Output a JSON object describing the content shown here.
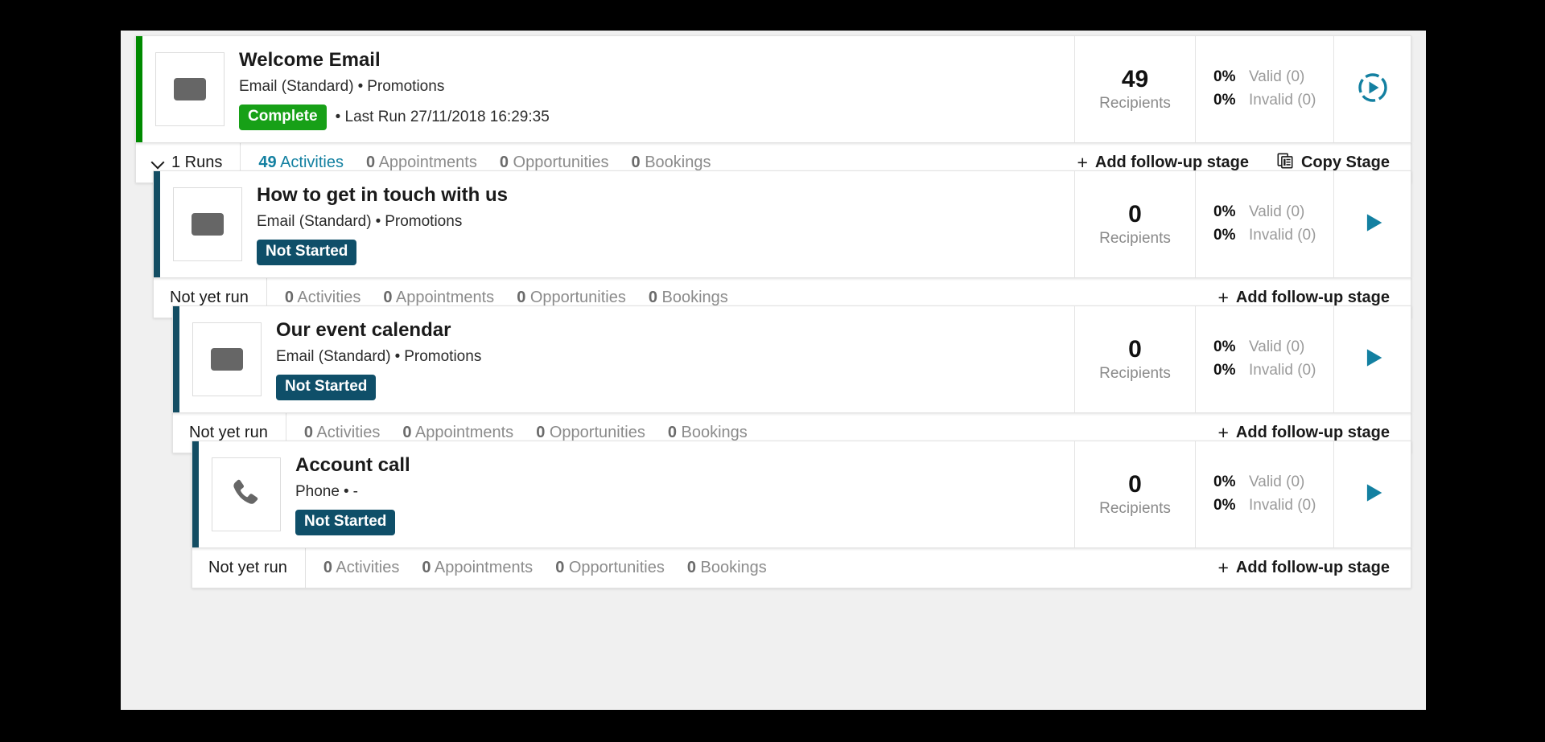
{
  "colors": {
    "accent_green": "#008a00",
    "accent_teal": "#134d63",
    "badge_complete": "#17a017",
    "badge_notstarted": "#0f4f69",
    "link_teal": "#1380a1",
    "play_teal": "#1380a1"
  },
  "stages": [
    {
      "id": "welcome-email",
      "title": "Welcome Email",
      "channel": "Email (Standard)",
      "separator": "•",
      "category": "Promotions",
      "status": "Complete",
      "status_kind": "complete",
      "last_run": "• Last Run 27/11/2018 16:29:35",
      "icon": "envelope-icon",
      "accent": "green",
      "metric_value": "49",
      "metric_label": "Recipients",
      "valid_pct": "0%",
      "valid_label": "Valid (0)",
      "invalid_pct": "0%",
      "invalid_label": "Invalid (0)",
      "action_icon": "play-progress-circle-icon",
      "runs_label": "1 Runs",
      "has_chevron": true,
      "tabs": [
        {
          "count": "49",
          "label": "Activities",
          "active": true
        },
        {
          "count": "0",
          "label": "Appointments",
          "active": false
        },
        {
          "count": "0",
          "label": "Opportunities",
          "active": false
        },
        {
          "count": "0",
          "label": "Bookings",
          "active": false
        }
      ],
      "add_stage_label": "Add follow-up stage",
      "add_stage_plus": "+",
      "copy_stage_label": "Copy Stage",
      "show_copy_stage": true
    },
    {
      "id": "how-to-get-in-touch-with-us",
      "title": "How to get in touch with us",
      "channel": "Email (Standard)",
      "separator": "•",
      "category": "Promotions",
      "status": "Not Started",
      "status_kind": "notstarted",
      "last_run": "",
      "icon": "envelope-icon",
      "accent": "teal",
      "metric_value": "0",
      "metric_label": "Recipients",
      "valid_pct": "0%",
      "valid_label": "Valid (0)",
      "invalid_pct": "0%",
      "invalid_label": "Invalid (0)",
      "action_icon": "play-icon",
      "runs_label": "Not yet run",
      "has_chevron": false,
      "tabs": [
        {
          "count": "0",
          "label": "Activities",
          "active": false
        },
        {
          "count": "0",
          "label": "Appointments",
          "active": false
        },
        {
          "count": "0",
          "label": "Opportunities",
          "active": false
        },
        {
          "count": "0",
          "label": "Bookings",
          "active": false
        }
      ],
      "add_stage_label": "Add follow-up stage",
      "add_stage_plus": "+",
      "copy_stage_label": "",
      "show_copy_stage": false
    },
    {
      "id": "our-event-calendar",
      "title": "Our event calendar",
      "channel": "Email (Standard)",
      "separator": "•",
      "category": "Promotions",
      "status": "Not Started",
      "status_kind": "notstarted",
      "last_run": "",
      "icon": "envelope-icon",
      "accent": "teal",
      "metric_value": "0",
      "metric_label": "Recipients",
      "valid_pct": "0%",
      "valid_label": "Valid (0)",
      "invalid_pct": "0%",
      "invalid_label": "Invalid (0)",
      "action_icon": "play-icon",
      "runs_label": "Not yet run",
      "has_chevron": false,
      "tabs": [
        {
          "count": "0",
          "label": "Activities",
          "active": false
        },
        {
          "count": "0",
          "label": "Appointments",
          "active": false
        },
        {
          "count": "0",
          "label": "Opportunities",
          "active": false
        },
        {
          "count": "0",
          "label": "Bookings",
          "active": false
        }
      ],
      "add_stage_label": "Add follow-up stage",
      "add_stage_plus": "+",
      "copy_stage_label": "",
      "show_copy_stage": false
    },
    {
      "id": "account-call",
      "title": "Account call",
      "channel": "Phone",
      "separator": "•",
      "category": "-",
      "status": "Not Started",
      "status_kind": "notstarted",
      "last_run": "",
      "icon": "phone-icon",
      "accent": "teal",
      "metric_value": "0",
      "metric_label": "Recipients",
      "valid_pct": "0%",
      "valid_label": "Valid (0)",
      "invalid_pct": "0%",
      "invalid_label": "Invalid (0)",
      "action_icon": "play-icon",
      "runs_label": "Not yet run",
      "has_chevron": false,
      "tabs": [
        {
          "count": "0",
          "label": "Activities",
          "active": false
        },
        {
          "count": "0",
          "label": "Appointments",
          "active": false
        },
        {
          "count": "0",
          "label": "Opportunities",
          "active": false
        },
        {
          "count": "0",
          "label": "Bookings",
          "active": false
        }
      ],
      "add_stage_label": "Add follow-up stage",
      "add_stage_plus": "+",
      "copy_stage_label": "",
      "show_copy_stage": false
    }
  ]
}
